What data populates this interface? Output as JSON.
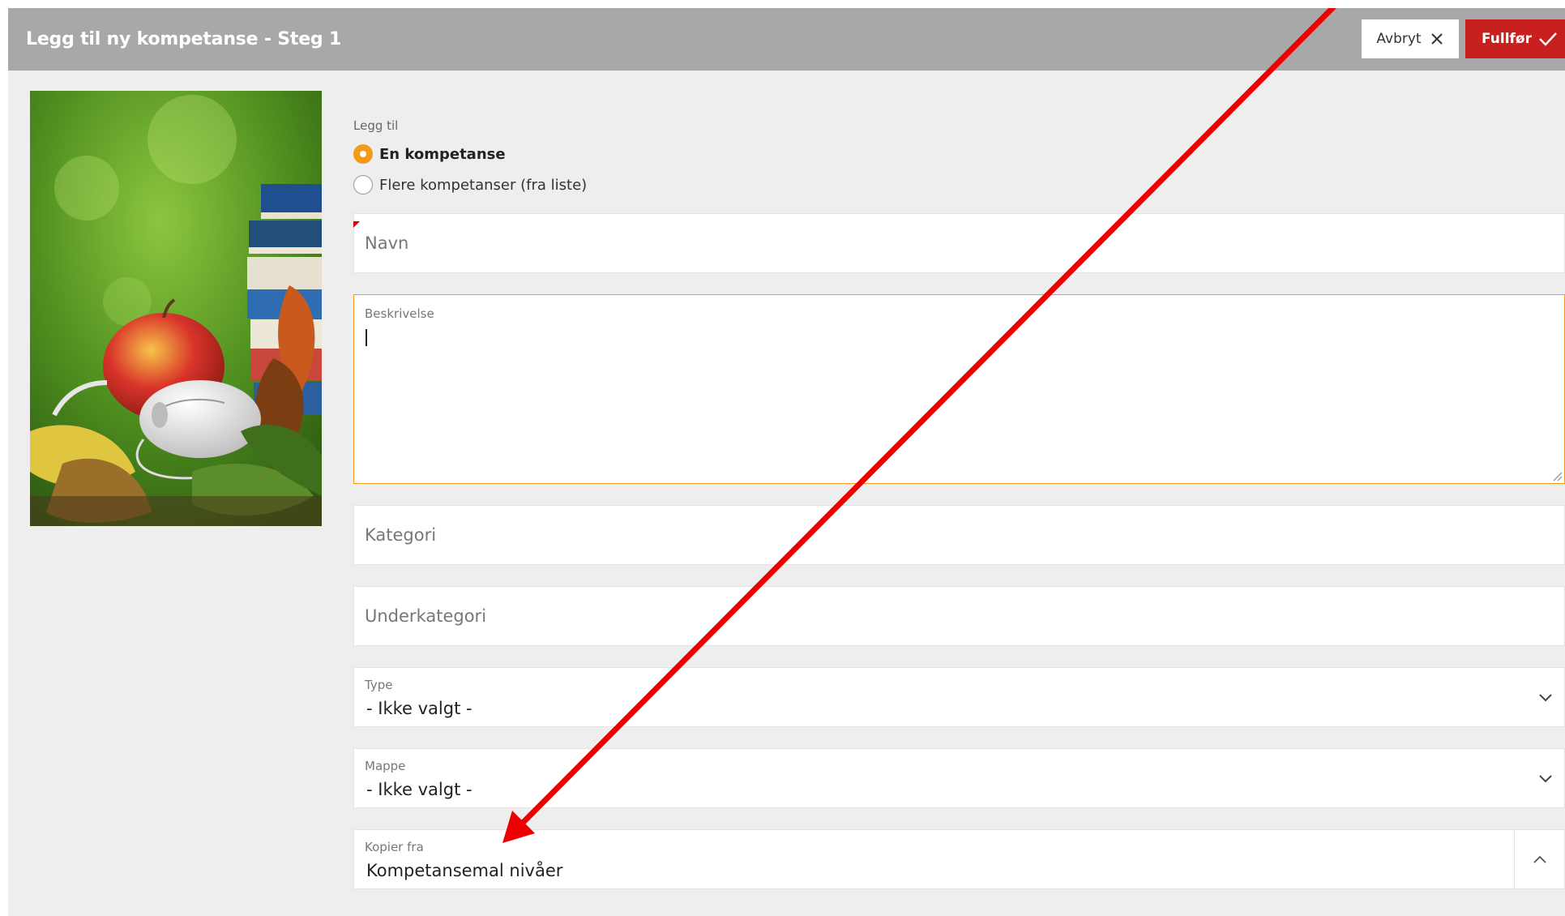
{
  "header": {
    "title": "Legg til ny kompetanse - Steg 1",
    "cancel_label": "Avbryt",
    "finish_label": "Fullfør"
  },
  "add_mode": {
    "label": "Legg til",
    "options": [
      {
        "label": "En kompetanse",
        "selected": true
      },
      {
        "label": "Flere kompetanser (fra liste)",
        "selected": false
      }
    ]
  },
  "form": {
    "name_placeholder": "Navn",
    "description_label": "Beskrivelse",
    "category_placeholder": "Kategori",
    "subcategory_placeholder": "Underkategori",
    "type": {
      "label": "Type",
      "value": "- Ikke valgt -"
    },
    "folder": {
      "label": "Mappe",
      "value": "- Ikke valgt -"
    },
    "copy_from": {
      "label": "Kopier fra",
      "value": "Kompetansemal nivåer"
    }
  },
  "colors": {
    "header_bg": "#a8a8a8",
    "finish_bg": "#c8201e",
    "accent_orange": "#f29a1c",
    "annotation_red": "#ee0000"
  },
  "icons": {
    "cancel": "close-icon",
    "finish": "checkmark-icon",
    "dropdown": "chevron-down-icon",
    "copy_toggle": "chevron-up-icon"
  }
}
